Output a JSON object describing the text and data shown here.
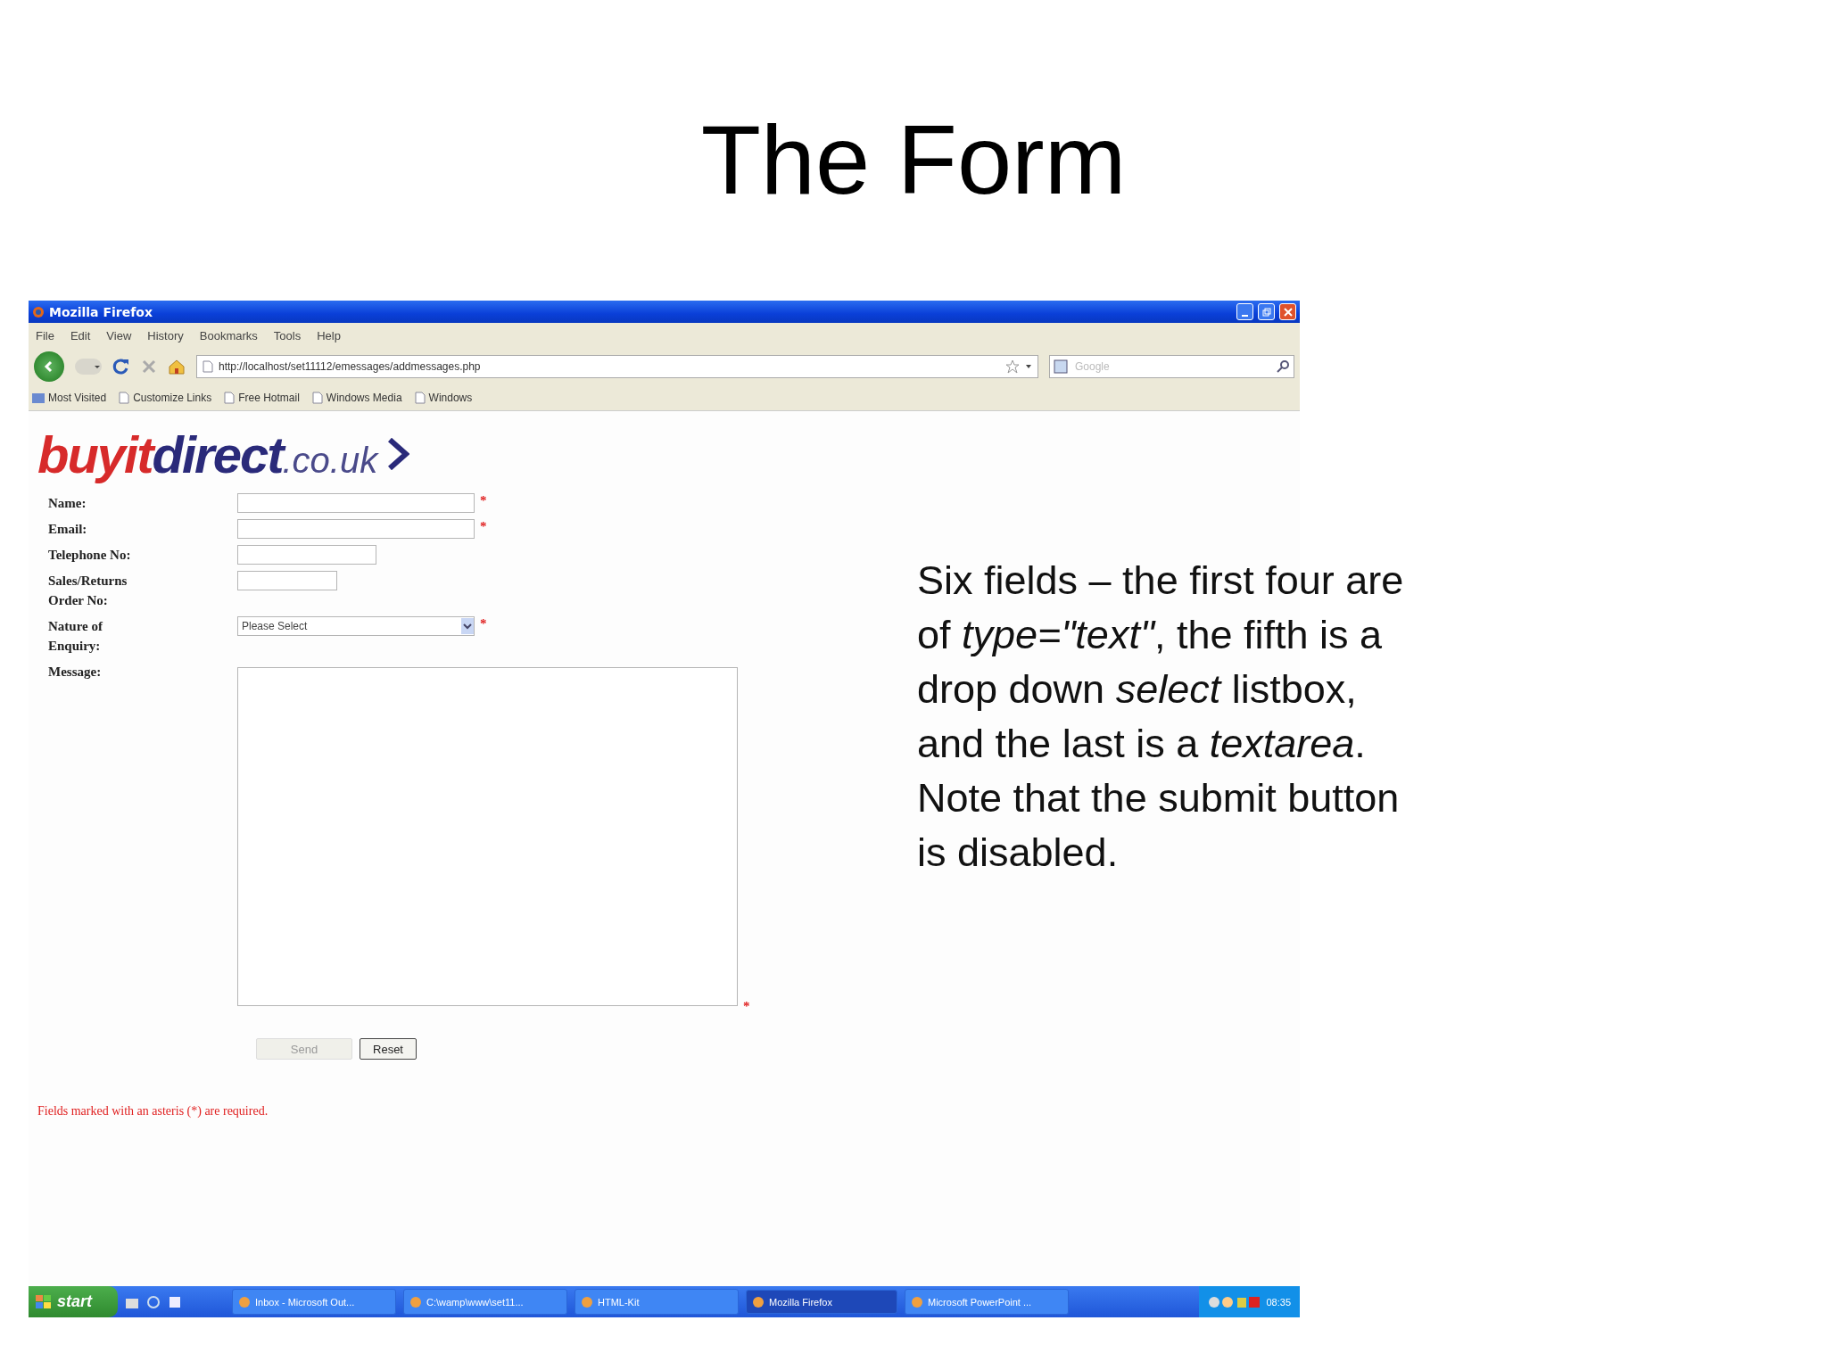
{
  "slide": {
    "title": "The Form",
    "caption": "Six fields – the first four are of *type=\"text\"*, the fifth is a drop down *select* listbox, and the last is a *textarea*. Note that the submit button is disabled."
  },
  "window": {
    "title": "Mozilla Firefox"
  },
  "menu": [
    "File",
    "Edit",
    "View",
    "History",
    "Bookmarks",
    "Tools",
    "Help"
  ],
  "toolbar": {
    "url": "http://localhost/set11112/emessages/addmessages.php",
    "search_placeholder": "Google"
  },
  "bookmarks": [
    "Most Visited",
    "Customize Links",
    "Free Hotmail",
    "Windows Media",
    "Windows"
  ],
  "page": {
    "logo": {
      "red_part": "buyit",
      "blue_part": "direct",
      "domain": ".co.uk"
    },
    "fields": [
      {
        "label": "Name:",
        "kind": "text",
        "required_mark": "*"
      },
      {
        "label": "Email:",
        "kind": "text",
        "required_mark": "*"
      },
      {
        "label": "Telephone No:",
        "kind": "text"
      },
      {
        "label": "Sales/Returns Order No:",
        "kind": "text"
      },
      {
        "label": "Nature of Enquiry:",
        "kind": "select",
        "value": "Please Select",
        "required_mark": "*"
      },
      {
        "label": "Message:",
        "kind": "textarea",
        "required_mark": "*"
      }
    ],
    "buttons": [
      {
        "label": "Send",
        "disabled": true
      },
      {
        "label": "Reset",
        "disabled": false
      }
    ],
    "note": "Fields marked with an asteris (*) are required."
  },
  "taskbar": {
    "start": "start",
    "tasks": [
      {
        "label": "Inbox - Microsoft Out...",
        "selected": false
      },
      {
        "label": "C:\\wamp\\www\\set11...",
        "selected": false
      },
      {
        "label": "HTML-Kit",
        "selected": false
      },
      {
        "label": "Mozilla Firefox",
        "selected": true
      },
      {
        "label": "Microsoft PowerPoint ...",
        "selected": false
      }
    ],
    "clock": "08:35"
  }
}
